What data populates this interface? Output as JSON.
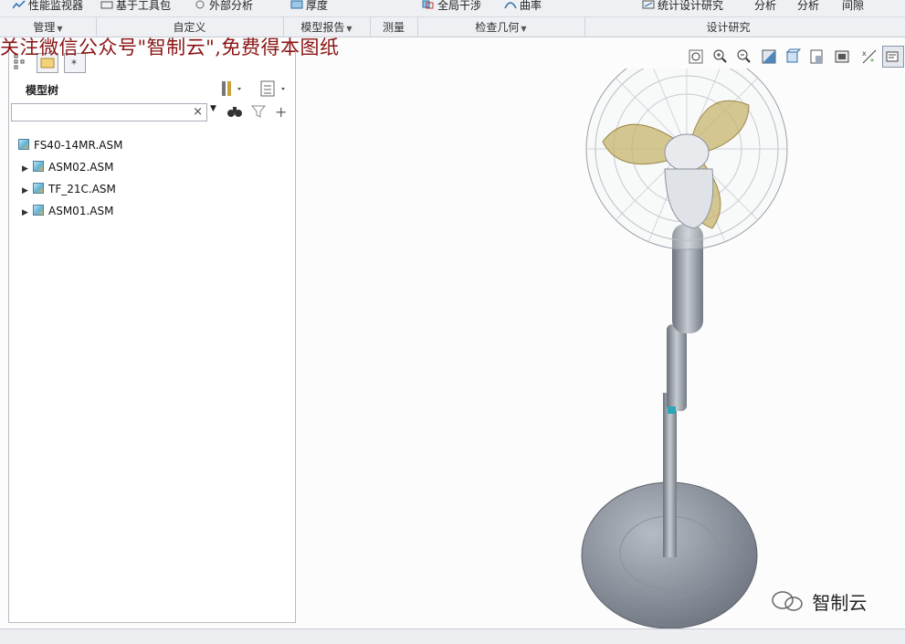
{
  "ribbon": {
    "top_items": [
      {
        "label": "性能监视器",
        "icon": "performance-monitor-icon"
      },
      {
        "label": "基于工具包",
        "icon": "toolkit-icon"
      },
      {
        "label": "外部分析",
        "icon": "external-analysis-icon"
      },
      {
        "label": "厚度",
        "icon": "thickness-icon"
      },
      {
        "label": "全局干涉",
        "icon": "global-interference-icon"
      },
      {
        "label": "曲率",
        "icon": "curvature-icon"
      },
      {
        "label": "统计设计研究",
        "icon": "statistical-design-study-icon"
      },
      {
        "label": "分析"
      },
      {
        "label": "分析"
      },
      {
        "label": "间隙"
      }
    ],
    "groups": [
      {
        "label": "管理",
        "has_dropdown": true
      },
      {
        "label": "自定义",
        "has_dropdown": false
      },
      {
        "label": "模型报告",
        "has_dropdown": true
      },
      {
        "label": "测量",
        "has_dropdown": false
      },
      {
        "label": "检查几何",
        "has_dropdown": true
      },
      {
        "label": "设计研究",
        "has_dropdown": false
      }
    ]
  },
  "watermark": "关注微信公众号\"智制云\",免费得本图纸",
  "model_tree": {
    "title": "模型树",
    "search_value": "",
    "root": {
      "label": "FS40-14MR.ASM",
      "icon": "assembly-icon"
    },
    "items": [
      {
        "label": "ASM02.ASM",
        "icon": "assembly-icon",
        "collapsed": true
      },
      {
        "label": "TF_21C.ASM",
        "icon": "assembly-icon",
        "collapsed": true
      },
      {
        "label": "ASM01.ASM",
        "icon": "assembly-icon",
        "collapsed": true
      }
    ]
  },
  "view_toolbar": {
    "buttons": [
      {
        "icon": "refit-icon"
      },
      {
        "icon": "zoom-in-icon"
      },
      {
        "icon": "zoom-out-icon"
      },
      {
        "icon": "repaint-icon"
      },
      {
        "icon": "display-style-icon"
      },
      {
        "icon": "saved-orientations-icon"
      },
      {
        "icon": "view-manager-icon"
      },
      {
        "icon": "datum-display-icon"
      },
      {
        "icon": "annotation-display-icon"
      }
    ]
  },
  "brand": {
    "text": "智制云",
    "icon": "wechat-icon"
  },
  "colors": {
    "watermark": "#8a1414",
    "fan_body": "#8e949e",
    "blade": "#c8b46e"
  }
}
